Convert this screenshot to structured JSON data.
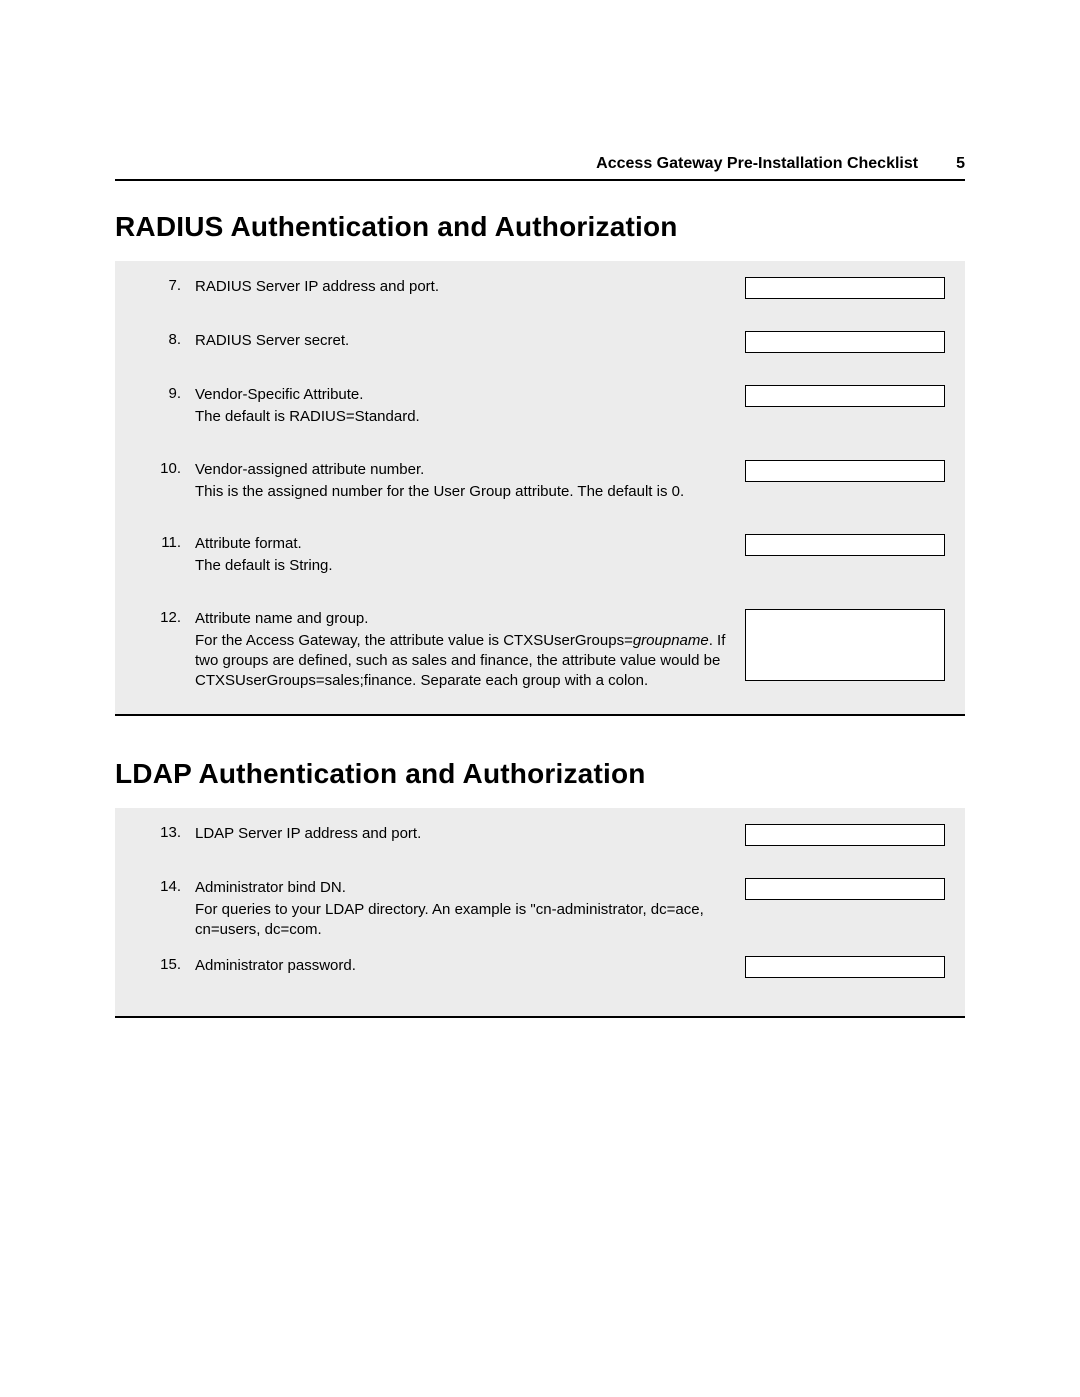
{
  "header": {
    "title": "Access Gateway Pre-Installation Checklist",
    "page_number": "5"
  },
  "radius": {
    "heading": "RADIUS Authentication and Authorization",
    "items": {
      "n7": {
        "num": "7.",
        "label": "RADIUS Server IP address and port.",
        "value": ""
      },
      "n8": {
        "num": "8.",
        "label": "RADIUS Server secret.",
        "value": ""
      },
      "n9": {
        "num": "9.",
        "label": "Vendor-Specific Attribute.",
        "desc": "The default is RADIUS=Standard.",
        "value": ""
      },
      "n10": {
        "num": "10.",
        "label": "Vendor-assigned attribute number.",
        "desc": "This is the assigned number for the User Group attribute. The default is 0.",
        "value": ""
      },
      "n11": {
        "num": "11.",
        "label": "Attribute format.",
        "desc": "The default is String.",
        "value": ""
      },
      "n12": {
        "num": "12.",
        "label": "Attribute name and group.",
        "desc_pre": "For the Access Gateway, the attribute value is CTXSUserGroups=",
        "desc_em": "groupname",
        "desc_post": ". If two groups are defined, such as sales and finance, the attribute value would be CTXSUserGroups=sales;finance. Separate each group with a colon.",
        "value": ""
      }
    }
  },
  "ldap": {
    "heading": "LDAP Authentication and Authorization",
    "items": {
      "n13": {
        "num": "13.",
        "label": "LDAP Server IP address and port.",
        "value": ""
      },
      "n14": {
        "num": "14.",
        "label": "Administrator bind DN.",
        "desc": "For queries to your LDAP directory. An example is \"cn-administrator, dc=ace, cn=users, dc=com.",
        "value": ""
      },
      "n15": {
        "num": "15.",
        "label": "Administrator password.",
        "value": ""
      }
    }
  }
}
